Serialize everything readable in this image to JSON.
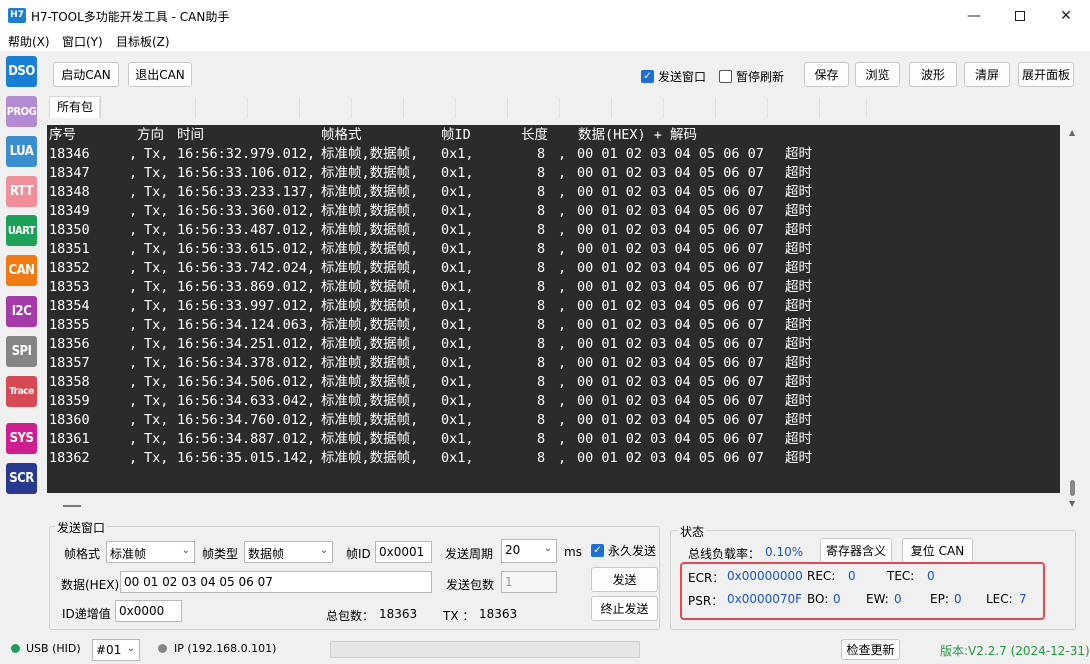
{
  "window": {
    "icon_text": "H7",
    "title": "H7-TOOL多功能开发工具 - CAN助手"
  },
  "menu": [
    "帮助(X)",
    "窗口(Y)",
    "目标板(Z)"
  ],
  "sidebar": [
    {
      "label": "DSO",
      "color": "#1a7fd4"
    },
    {
      "label": "PROG",
      "color": "#b48ad2"
    },
    {
      "label": "LUA",
      "color": "#3b8fd1"
    },
    {
      "label": "RTT",
      "color": "#f08f9a"
    },
    {
      "label": "UART",
      "color": "#1da15a"
    },
    {
      "label": "CAN",
      "color": "#f07a14"
    },
    {
      "label": "I2C",
      "color": "#a43ba8"
    },
    {
      "label": "SPI",
      "color": "#858585"
    },
    {
      "label": "Trace",
      "color": "#d74a55"
    },
    {
      "label": "SYS",
      "color": "#cf1e8e"
    },
    {
      "label": "SCR",
      "color": "#283a8f"
    }
  ],
  "toolbar": {
    "start_can": "启动CAN",
    "exit_can": "退出CAN",
    "send_window_label": "发送窗口",
    "send_window_checked": true,
    "pause_refresh_label": "暂停刷新",
    "pause_refresh_checked": false,
    "save": "保存",
    "browse": "浏览",
    "wave": "波形",
    "clear": "清屏",
    "expand": "展开面板"
  },
  "tabs": {
    "active": "所有包"
  },
  "console": {
    "header": {
      "seq": "序号",
      "dir": "方向",
      "time": "时间",
      "format": "帧格式",
      "id": "帧ID",
      "len": "长度",
      "data": "数据(HEX) + 解码"
    },
    "rows": [
      {
        "seq": "18346",
        "dir": "Tx,",
        "time": "16:56:32.979.012,",
        "format": "标准帧,数据帧,",
        "id": "0x1,",
        "len": "8",
        "data": "00 01 02 03 04 05 06 07",
        "note": "超时"
      },
      {
        "seq": "18347",
        "dir": "Tx,",
        "time": "16:56:33.106.012,",
        "format": "标准帧,数据帧,",
        "id": "0x1,",
        "len": "8",
        "data": "00 01 02 03 04 05 06 07",
        "note": "超时"
      },
      {
        "seq": "18348",
        "dir": "Tx,",
        "time": "16:56:33.233.137,",
        "format": "标准帧,数据帧,",
        "id": "0x1,",
        "len": "8",
        "data": "00 01 02 03 04 05 06 07",
        "note": "超时"
      },
      {
        "seq": "18349",
        "dir": "Tx,",
        "time": "16:56:33.360.012,",
        "format": "标准帧,数据帧,",
        "id": "0x1,",
        "len": "8",
        "data": "00 01 02 03 04 05 06 07",
        "note": "超时"
      },
      {
        "seq": "18350",
        "dir": "Tx,",
        "time": "16:56:33.487.012,",
        "format": "标准帧,数据帧,",
        "id": "0x1,",
        "len": "8",
        "data": "00 01 02 03 04 05 06 07",
        "note": "超时"
      },
      {
        "seq": "18351",
        "dir": "Tx,",
        "time": "16:56:33.615.012,",
        "format": "标准帧,数据帧,",
        "id": "0x1,",
        "len": "8",
        "data": "00 01 02 03 04 05 06 07",
        "note": "超时"
      },
      {
        "seq": "18352",
        "dir": "Tx,",
        "time": "16:56:33.742.024,",
        "format": "标准帧,数据帧,",
        "id": "0x1,",
        "len": "8",
        "data": "00 01 02 03 04 05 06 07",
        "note": "超时"
      },
      {
        "seq": "18353",
        "dir": "Tx,",
        "time": "16:56:33.869.012,",
        "format": "标准帧,数据帧,",
        "id": "0x1,",
        "len": "8",
        "data": "00 01 02 03 04 05 06 07",
        "note": "超时"
      },
      {
        "seq": "18354",
        "dir": "Tx,",
        "time": "16:56:33.997.012,",
        "format": "标准帧,数据帧,",
        "id": "0x1,",
        "len": "8",
        "data": "00 01 02 03 04 05 06 07",
        "note": "超时"
      },
      {
        "seq": "18355",
        "dir": "Tx,",
        "time": "16:56:34.124.063,",
        "format": "标准帧,数据帧,",
        "id": "0x1,",
        "len": "8",
        "data": "00 01 02 03 04 05 06 07",
        "note": "超时"
      },
      {
        "seq": "18356",
        "dir": "Tx,",
        "time": "16:56:34.251.012,",
        "format": "标准帧,数据帧,",
        "id": "0x1,",
        "len": "8",
        "data": "00 01 02 03 04 05 06 07",
        "note": "超时"
      },
      {
        "seq": "18357",
        "dir": "Tx,",
        "time": "16:56:34.378.012,",
        "format": "标准帧,数据帧,",
        "id": "0x1,",
        "len": "8",
        "data": "00 01 02 03 04 05 06 07",
        "note": "超时"
      },
      {
        "seq": "18358",
        "dir": "Tx,",
        "time": "16:56:34.506.012,",
        "format": "标准帧,数据帧,",
        "id": "0x1,",
        "len": "8",
        "data": "00 01 02 03 04 05 06 07",
        "note": "超时"
      },
      {
        "seq": "18359",
        "dir": "Tx,",
        "time": "16:56:34.633.042,",
        "format": "标准帧,数据帧,",
        "id": "0x1,",
        "len": "8",
        "data": "00 01 02 03 04 05 06 07",
        "note": "超时"
      },
      {
        "seq": "18360",
        "dir": "Tx,",
        "time": "16:56:34.760.012,",
        "format": "标准帧,数据帧,",
        "id": "0x1,",
        "len": "8",
        "data": "00 01 02 03 04 05 06 07",
        "note": "超时"
      },
      {
        "seq": "18361",
        "dir": "Tx,",
        "time": "16:56:34.887.012,",
        "format": "标准帧,数据帧,",
        "id": "0x1,",
        "len": "8",
        "data": "00 01 02 03 04 05 06 07",
        "note": "超时"
      },
      {
        "seq": "18362",
        "dir": "Tx,",
        "time": "16:56:35.015.142,",
        "format": "标准帧,数据帧,",
        "id": "0x1,",
        "len": "8",
        "data": "00 01 02 03 04 05 06 07",
        "note": "超时"
      }
    ]
  },
  "send": {
    "title": "发送窗口",
    "frame_format_label": "帧格式",
    "frame_format_value": "标准帧",
    "frame_type_label": "帧类型",
    "frame_type_value": "数据帧",
    "id_label": "帧ID",
    "id_value": "0x0001",
    "period_label": "发送周期",
    "period_value": "20",
    "period_unit": "ms",
    "forever_label": "永久发送",
    "forever_checked": true,
    "data_label": "数据(HEX)",
    "data_value": "00 01 02 03 04 05 06 07",
    "count_label": "发送包数",
    "count_value": "1",
    "send_button": "发送",
    "id_inc_label": "ID递增值",
    "id_inc_value": "0x0000",
    "total_label": "总包数：",
    "total_value": "18363",
    "tx_label": "TX ：",
    "tx_value": "18363",
    "stop_button": "终止发送"
  },
  "status": {
    "title": "状态",
    "bus_load_label": "总线负载率：",
    "bus_load_value": "0.10%",
    "reg_meaning_button": "寄存器含义",
    "reset_can_button": "复位 CAN",
    "ecr_label": "ECR：",
    "ecr_value": "0x00000000",
    "rec_label": "REC:",
    "rec_value": "0",
    "tec_label": "TEC:",
    "tec_value": "0",
    "psr_label": "PSR：",
    "psr_value": "0x0000070F",
    "bo_label": "BO:",
    "bo_value": "0",
    "ew_label": "EW:",
    "ew_value": "0",
    "ep_label": "EP:",
    "ep_value": "0",
    "lec_label": "LEC:",
    "lec_value": "7"
  },
  "statusbar": {
    "usb_text": "USB (HID)",
    "usb_color": "#1da15a",
    "device_value": "#01",
    "ip_text": "IP (192.168.0.101)",
    "check_update": "检查更新",
    "version": "版本:V2.2.7 (2024-12-31)"
  }
}
